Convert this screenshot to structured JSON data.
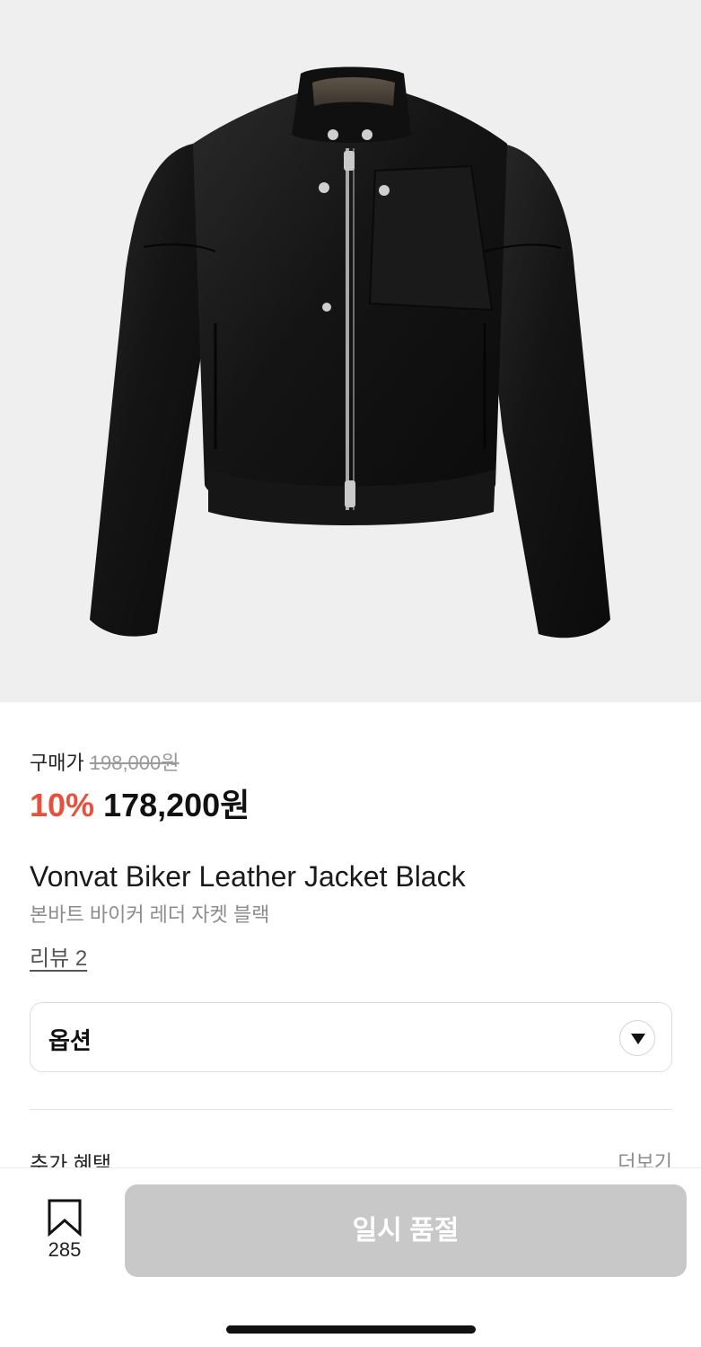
{
  "product_image": {
    "icon": "black-leather-biker-jacket-photo",
    "background": "#efefef"
  },
  "pricing": {
    "label": "구매가",
    "original_price": "198,000원",
    "discount": "10%",
    "final_price": "178,200원",
    "discount_color": "#e6503c"
  },
  "product": {
    "name": "Vonvat Biker Leather Jacket Black",
    "name_ko": "본바트 바이커 레더 자켓 블랙",
    "reviews_link": "리뷰 2"
  },
  "option_selector": {
    "label": "옵션",
    "icon": "chevron-down-icon"
  },
  "benefits": {
    "label": "추가 혜택",
    "more": "더보기"
  },
  "bottom_bar": {
    "bookmark_icon": "bookmark-icon",
    "bookmark_count": "285",
    "buy_button": "일시 품절",
    "buy_button_color": "#c8c8c8"
  }
}
